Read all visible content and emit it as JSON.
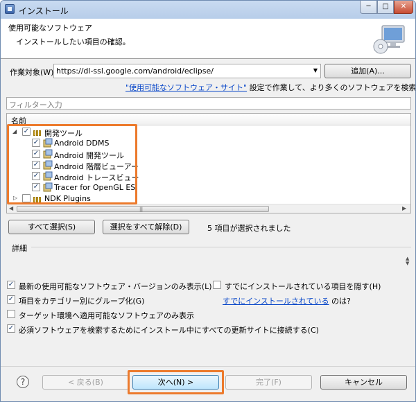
{
  "window": {
    "title": "インストール"
  },
  "header": {
    "title": "使用可能なソフトウェア",
    "description": "インストールしたい項目の確認。"
  },
  "work_with": {
    "label": "作業対象(W):",
    "value": "https://dl-ssl.google.com/android/eclipse/",
    "add_button": "追加(A)..."
  },
  "info": {
    "link": "\"使用可能なソフトウェア・サイト\"",
    "text": " 設定で作業して、より多くのソフトウェアを検索してください。"
  },
  "filter": {
    "placeholder": "フィルター入力"
  },
  "tree": {
    "column_header": "名前",
    "items": [
      {
        "label": "開発ツール",
        "checked": true,
        "expanded": true
      },
      {
        "label": "Android DDMS",
        "checked": true
      },
      {
        "label": "Android 開発ツール",
        "checked": true
      },
      {
        "label": "Android 階層ビューアー",
        "checked": true
      },
      {
        "label": "Android トレースビュー",
        "checked": true
      },
      {
        "label": "Tracer for OpenGL ES",
        "checked": true
      },
      {
        "label": "NDK Plugins",
        "checked": false,
        "expanded": false
      }
    ]
  },
  "selection": {
    "select_all": "すべて選択(S)",
    "deselect_all": "選択をすべて解除(D)",
    "count_text": "5 項目が選択されました"
  },
  "details": {
    "label": "詳細"
  },
  "options": {
    "latest_only": "最新の使用可能なソフトウェア・バージョンのみ表示(L)",
    "hide_installed": "すでにインストールされている項目を隠す(H)",
    "group_by_category": "項目をカテゴリー別にグループ化(G)",
    "already_installed_link": "すでにインストールされている",
    "already_installed_suffix": " のは?",
    "target_env_only": "ターゲット環境へ適用可能なソフトウェアのみ表示",
    "contact_all_sites": "必須ソフトウェアを検索するためにインストール中にすべての更新サイトに接続する(C)"
  },
  "buttons": {
    "back": "< 戻る(B)",
    "next": "次へ(N) >",
    "finish": "完了(F)",
    "cancel": "キャンセル"
  },
  "colors": {
    "highlight": "#ec7a2c",
    "link": "#0645c8"
  }
}
